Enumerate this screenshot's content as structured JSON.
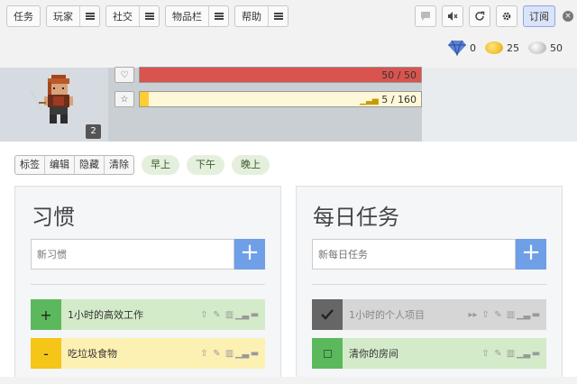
{
  "nav": {
    "items": [
      {
        "label": "任务",
        "has_menu": false
      },
      {
        "label": "玩家",
        "has_menu": true
      },
      {
        "label": "社交",
        "has_menu": true
      },
      {
        "label": "物品栏",
        "has_menu": true
      },
      {
        "label": "帮助",
        "has_menu": true
      }
    ]
  },
  "toolbar": {
    "subscribe_label": "订阅",
    "icons": [
      "chat-icon",
      "mute-icon",
      "sync-icon",
      "gear-icon"
    ]
  },
  "currency": {
    "gems": "0",
    "gold": "25",
    "silver": "50"
  },
  "stats": {
    "health_text": "50 / 50",
    "health_fraction": 1.0,
    "xp_text": "5 / 160",
    "xp_fraction": 0.03125,
    "level": "2"
  },
  "filters": {
    "tags": [
      "标签",
      "编辑",
      "隐藏",
      "清除"
    ],
    "times": [
      "早上",
      "下午",
      "晚上"
    ]
  },
  "habits": {
    "title": "习惯",
    "placeholder": "新习惯",
    "add_label": "+",
    "items": [
      {
        "label": "1小时的高效工作",
        "ctrl": "+"
      },
      {
        "label": "吃垃圾食物",
        "ctrl": "-"
      }
    ]
  },
  "dailies": {
    "title": "每日任务",
    "placeholder": "新每日任务",
    "add_label": "+",
    "items": [
      {
        "label": "1小时的个人项目",
        "ctrl": "check"
      },
      {
        "label": "清你的房间",
        "ctrl": "box"
      }
    ]
  },
  "colors": {
    "health": "#d9534f",
    "xp": "#ffcc33",
    "habit_positive": "#5cb85c",
    "habit_negative": "#f5c518",
    "add_button": "#6f9fe6",
    "daily_done": "#666666"
  }
}
